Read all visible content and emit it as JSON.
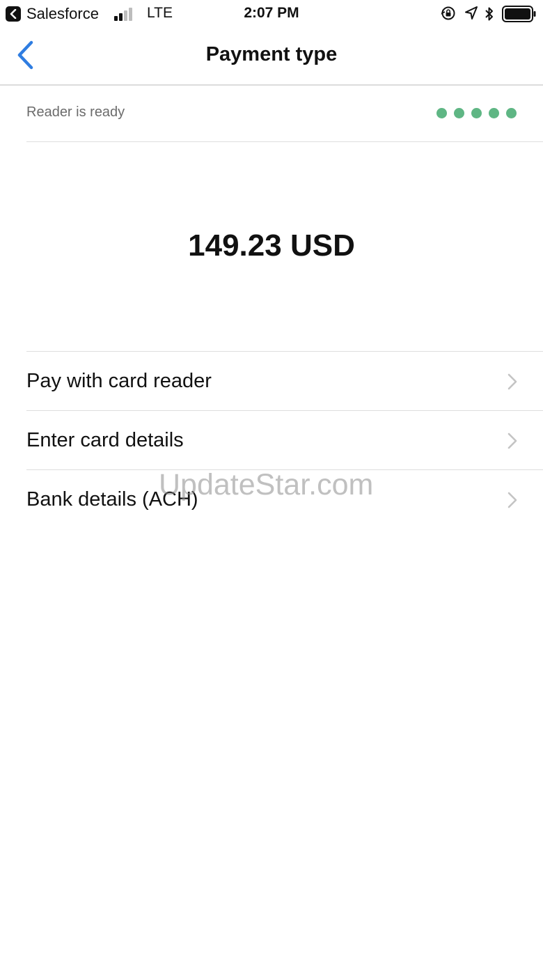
{
  "status_bar": {
    "app_name": "Salesforce",
    "network": "LTE",
    "time": "2:07 PM",
    "icons": [
      "back-to-app-icon",
      "signal-icon",
      "orientation-lock-icon",
      "location-icon",
      "bluetooth-icon",
      "battery-icon"
    ]
  },
  "nav": {
    "title": "Payment type",
    "back_icon": "chevron-left-icon"
  },
  "reader": {
    "status_text": "Reader is ready",
    "indicator_color": "#5fb684",
    "indicator_count": 5
  },
  "amount": {
    "text": "149.23 USD"
  },
  "options": [
    {
      "label": "Pay with card reader",
      "icon": "chevron-right-icon"
    },
    {
      "label": "Enter card details",
      "icon": "chevron-right-icon"
    },
    {
      "label": "Bank details (ACH)",
      "icon": "chevron-right-icon"
    }
  ],
  "watermark": {
    "text": "UpdateStar.com"
  },
  "colors": {
    "accent": "#2f7de1",
    "divider": "#dedede",
    "secondary_text": "#6b6b6b"
  }
}
